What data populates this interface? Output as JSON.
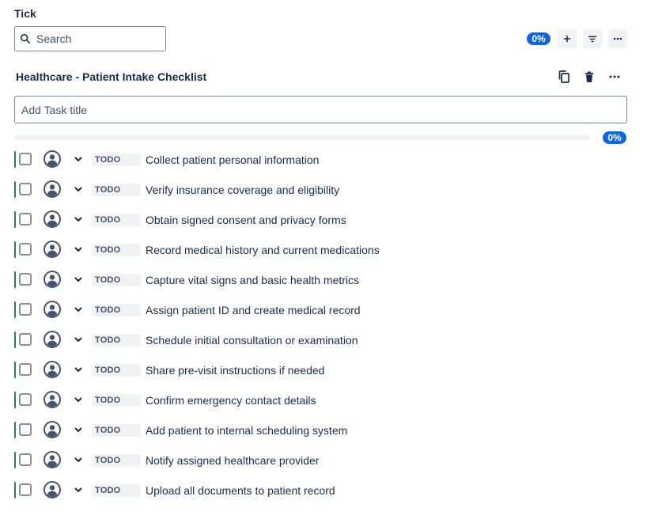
{
  "app": {
    "title": "Tick"
  },
  "search": {
    "placeholder": "Search"
  },
  "toolbar": {
    "percent": "0%",
    "add_icon": "plus-icon",
    "filter_icon": "filter-icon",
    "more_icon": "more-horizontal-icon"
  },
  "checklist": {
    "title": "Healthcare - Patient Intake Checklist",
    "add_placeholder": "Add Task title",
    "progress_percent": "0%",
    "progress_fraction": 0,
    "header_icons": [
      "copy-icon",
      "trash-icon",
      "more-horizontal-icon"
    ],
    "accent_color": "#1f845a",
    "badge_color": "#0c66e4"
  },
  "tasks": [
    {
      "status": "TODO",
      "text": "Collect patient personal information"
    },
    {
      "status": "TODO",
      "text": "Verify insurance coverage and eligibility"
    },
    {
      "status": "TODO",
      "text": "Obtain signed consent and privacy forms"
    },
    {
      "status": "TODO",
      "text": "Record medical history and current medications"
    },
    {
      "status": "TODO",
      "text": "Capture vital signs and basic health metrics"
    },
    {
      "status": "TODO",
      "text": "Assign patient ID and create medical record"
    },
    {
      "status": "TODO",
      "text": "Schedule initial consultation or examination"
    },
    {
      "status": "TODO",
      "text": "Share pre-visit instructions if needed"
    },
    {
      "status": "TODO",
      "text": "Confirm emergency contact details"
    },
    {
      "status": "TODO",
      "text": "Add patient to internal scheduling system"
    },
    {
      "status": "TODO",
      "text": "Notify assigned healthcare provider"
    },
    {
      "status": "TODO",
      "text": "Upload all documents to patient record"
    }
  ]
}
